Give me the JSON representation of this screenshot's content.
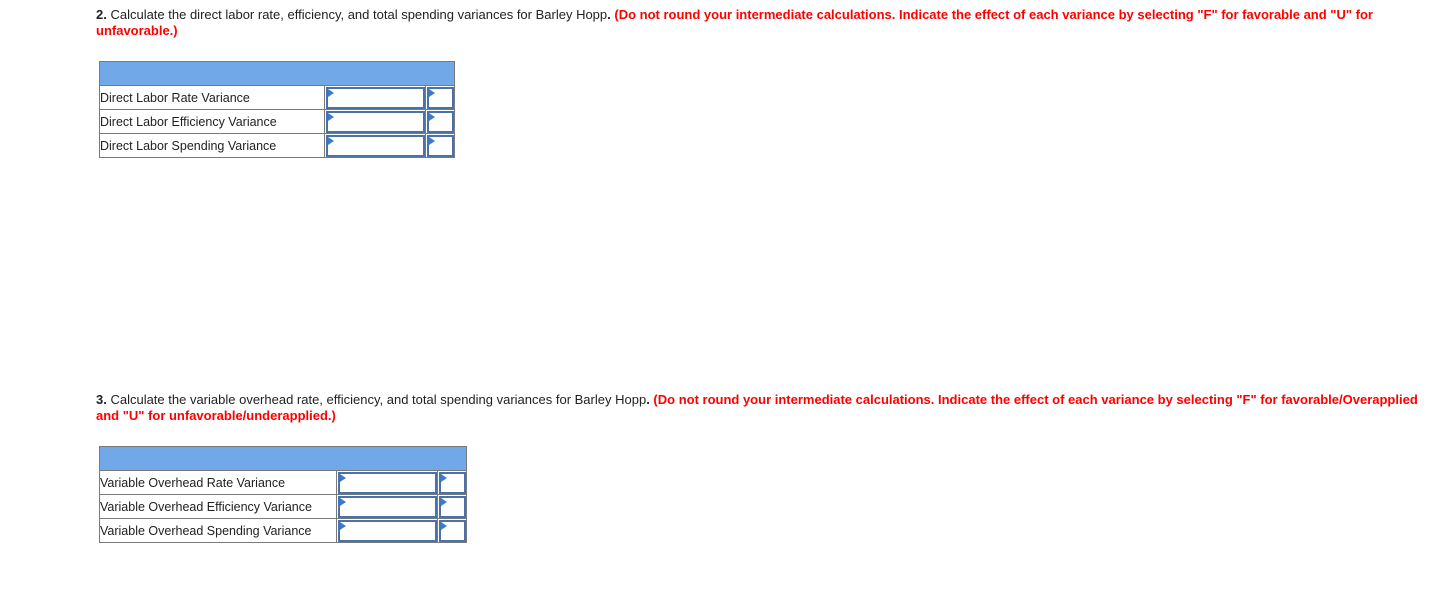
{
  "questions": [
    {
      "number": "2.",
      "text": " Calculate the direct labor rate, efficiency, and total spending variances for Barley Hopp",
      "period": ".",
      "instructions": " (Do not round your intermediate calculations. Indicate the effect of each variance by selecting \"F\" for favorable and \"U\" for unfavorable.)",
      "table": {
        "rows": [
          {
            "label": "Direct Labor Rate Variance",
            "amount": "",
            "effect": ""
          },
          {
            "label": "Direct Labor Efficiency Variance",
            "amount": "",
            "effect": ""
          },
          {
            "label": "Direct Labor Spending Variance",
            "amount": "",
            "effect": ""
          }
        ]
      }
    },
    {
      "number": "3.",
      "text": " Calculate the variable overhead rate, efficiency, and total spending variances for Barley Hopp",
      "period": ".",
      "instructions": " (Do not round your intermediate calculations. Indicate the effect of each variance by selecting \"F\" for favorable/Overapplied and \"U\" for unfavorable/underapplied.)",
      "table": {
        "rows": [
          {
            "label": "Variable Overhead Rate Variance",
            "amount": "",
            "effect": ""
          },
          {
            "label": "Variable Overhead Efficiency Variance",
            "amount": "",
            "effect": ""
          },
          {
            "label": "Variable Overhead Spending Variance",
            "amount": "",
            "effect": ""
          }
        ]
      }
    }
  ],
  "colors": {
    "header_fill": "#71a8e8",
    "instruction_text": "#ff0000",
    "input_border": "#4a72aa",
    "flag": "#3b7ad0"
  }
}
